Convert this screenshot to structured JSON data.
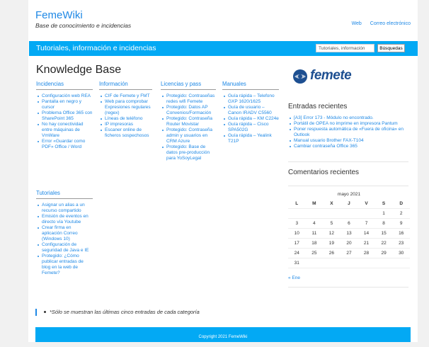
{
  "header": {
    "site_title": "FemeWiki",
    "site_description": "Base de conocimiento e incidencias",
    "nav": [
      "Web",
      "Correo electrónico"
    ]
  },
  "banner": {
    "title": "Tutoriales, información e incidencias",
    "search_placeholder": "Tutoriales, información",
    "search_button": "Búsquedas"
  },
  "main": {
    "title": "Knowledge Base",
    "categories": [
      {
        "name": "Incidencias",
        "items": [
          "Configuración web REA",
          "Pantalla en negro y cursor",
          "Problema Office 365 con SharePoint 365",
          "No hay conectividad entre máquinas de VmWare",
          "Error «Guardar como PDF» Office / Word"
        ]
      },
      {
        "name": "Información",
        "items": [
          "CIF de Femete y FMT",
          "Web para comprobar Expresiones regulares (regex)",
          "Líneas de teléfono",
          "IP impresoras",
          "Escaner online de ficheros sospechosos"
        ]
      },
      {
        "name": "Licencias y pass",
        "items": [
          "Protegido: Contraseñas redes wifi Femete",
          "Protegido: Datos AP Convenios/Formación",
          "Protegido: Contraseña Router Movistar",
          "Protegido: Contraseña admin y usuarios en CRM Azure",
          "Protegido: Base de datos pre-producción para YoSoyLegal"
        ]
      },
      {
        "name": "Manuales",
        "items": [
          "Guía rápida – Telefono GXP 1620/1625",
          "Guía de usuario – Canon IRADV C5560",
          "Guía rápida – KM C224e",
          "Guía rápida – Cisco SPA502G",
          "Guía rápida – Yealink T21P"
        ]
      },
      {
        "name": "Tutoriales",
        "items": [
          "Asignar un alias a un recurso compartido",
          "Emisión de eventos en directo vía Youtube",
          "Crear firma en aplicación Correo (Windows 10)",
          "Configuración de seguridad de Java e IE",
          "Protegido: ¿Cómo publicar entradas de blog en la web de Femete?"
        ]
      }
    ],
    "note": "*Sólo se muestran las últimas cinco entradas de cada categoría"
  },
  "sidebar": {
    "logo_text": "femete",
    "recent_title": "Entradas recientes",
    "recent_posts": [
      "[A3] Error 173 - Módulo no encontrado.",
      "Portátil de OPEA no imprime en impresora Pantum",
      "Poner respuesta automática de «Fuera de oficina» en Outlook",
      "Manual usuario Brother FAX-T104",
      "Cambiar contraseña Office 365"
    ],
    "comments_title": "Comentarios recientes",
    "calendar": {
      "caption": "mayo 2021",
      "weekdays": [
        "L",
        "M",
        "X",
        "J",
        "V",
        "S",
        "D"
      ],
      "weeks": [
        [
          "",
          "",
          "",
          "",
          "",
          "1",
          "2"
        ],
        [
          "3",
          "4",
          "5",
          "6",
          "7",
          "8",
          "9"
        ],
        [
          "10",
          "11",
          "12",
          "13",
          "14",
          "15",
          "16"
        ],
        [
          "17",
          "18",
          "19",
          "20",
          "21",
          "22",
          "23"
        ],
        [
          "24",
          "25",
          "26",
          "27",
          "28",
          "29",
          "30"
        ],
        [
          "31",
          "",
          "",
          "",
          "",
          "",
          ""
        ]
      ],
      "prev_link": "« Ene"
    }
  },
  "footer": {
    "copyright": "Copyright 2021 FemeWiki"
  }
}
